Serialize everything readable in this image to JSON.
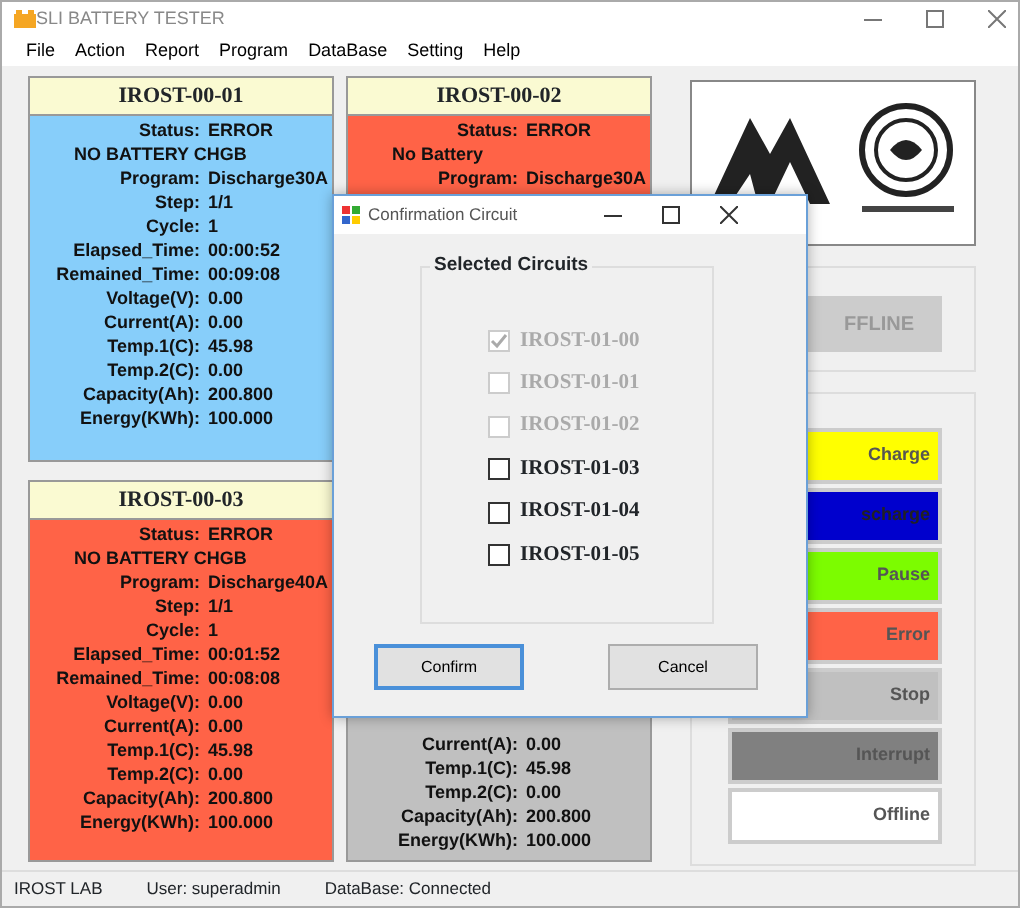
{
  "window": {
    "title": "SLI BATTERY TESTER"
  },
  "menu": [
    "File",
    "Action",
    "Report",
    "Program",
    "DataBase",
    "Setting",
    "Help"
  ],
  "circuits": [
    {
      "title": "IROST-00-01",
      "color": "#87cefa",
      "rows": [
        {
          "kind": "field",
          "label": "Status:",
          "value": "ERROR"
        },
        {
          "kind": "message",
          "text": "NO BATTERY CHGB"
        },
        {
          "kind": "field",
          "label": "Program:",
          "value": "Discharge30A"
        },
        {
          "kind": "field",
          "label": "Step:",
          "value": "1/1"
        },
        {
          "kind": "field",
          "label": "Cycle:",
          "value": "1"
        },
        {
          "kind": "field",
          "label": "Elapsed_Time:",
          "value": "00:00:52"
        },
        {
          "kind": "field",
          "label": "Remained_Time:",
          "value": "00:09:08"
        },
        {
          "kind": "field",
          "label": "Voltage(V):",
          "value": "0.00"
        },
        {
          "kind": "field",
          "label": "Current(A):",
          "value": "0.00"
        },
        {
          "kind": "field",
          "label": "Temp.1(C):",
          "value": "45.98"
        },
        {
          "kind": "field",
          "label": "Temp.2(C):",
          "value": "0.00"
        },
        {
          "kind": "field",
          "label": "Capacity(Ah):",
          "value": "200.800"
        },
        {
          "kind": "field",
          "label": "Energy(KWh):",
          "value": "100.000"
        }
      ]
    },
    {
      "title": "IROST-00-02",
      "color": "#ff6347",
      "rows": [
        {
          "kind": "field",
          "label": "Status:",
          "value": "ERROR"
        },
        {
          "kind": "message",
          "text": "No Battery"
        },
        {
          "kind": "field",
          "label": "Program:",
          "value": "Discharge30A"
        }
      ]
    },
    {
      "title": "IROST-00-03",
      "color": "#ff6347",
      "rows": [
        {
          "kind": "field",
          "label": "Status:",
          "value": "ERROR"
        },
        {
          "kind": "message",
          "text": "NO BATTERY CHGB"
        },
        {
          "kind": "field",
          "label": "Program:",
          "value": "Discharge40A"
        },
        {
          "kind": "field",
          "label": "Step:",
          "value": "1/1"
        },
        {
          "kind": "field",
          "label": "Cycle:",
          "value": "1"
        },
        {
          "kind": "field",
          "label": "Elapsed_Time:",
          "value": "00:01:52"
        },
        {
          "kind": "field",
          "label": "Remained_Time:",
          "value": "00:08:08"
        },
        {
          "kind": "field",
          "label": "Voltage(V):",
          "value": "0.00"
        },
        {
          "kind": "field",
          "label": "Current(A):",
          "value": "0.00"
        },
        {
          "kind": "field",
          "label": "Temp.1(C):",
          "value": "45.98"
        },
        {
          "kind": "field",
          "label": "Temp.2(C):",
          "value": "0.00"
        },
        {
          "kind": "field",
          "label": "Capacity(Ah):",
          "value": "200.800"
        },
        {
          "kind": "field",
          "label": "Energy(KWh):",
          "value": "100.000"
        }
      ]
    },
    {
      "color": "#c0c0c0",
      "rows": [
        {
          "kind": "field",
          "label": "Current(A):",
          "value": "0.00"
        },
        {
          "kind": "field",
          "label": "Temp.1(C):",
          "value": "45.98"
        },
        {
          "kind": "field",
          "label": "Temp.2(C):",
          "value": "0.00"
        },
        {
          "kind": "field",
          "label": "Capacity(Ah):",
          "value": "200.800"
        },
        {
          "kind": "field",
          "label": "Energy(KWh):",
          "value": "100.000"
        }
      ]
    }
  ],
  "mode_button": {
    "label": "FFLINE",
    "disabled": true
  },
  "legend": [
    {
      "label": "Charge",
      "color": "#ffff00"
    },
    {
      "label": "scharge",
      "color": "#0000cd"
    },
    {
      "label": "Pause",
      "color": "#7cfc00"
    },
    {
      "label": "Error",
      "color": "#ff6347"
    },
    {
      "label": "Stop",
      "color": "#c0c0c0"
    },
    {
      "label": "Interrupt",
      "color": "#808080"
    },
    {
      "label": "Offline",
      "color": "#ffffff"
    }
  ],
  "status_bar": [
    "IROST LAB",
    "User:  superadmin",
    "DataBase:  Connected"
  ],
  "dialog": {
    "title": "Confirmation Circuit",
    "group_title": "Selected Circuits",
    "items": [
      {
        "label": "IROST-01-00",
        "checked": true,
        "disabled": true
      },
      {
        "label": "IROST-01-01",
        "checked": false,
        "disabled": true
      },
      {
        "label": "IROST-01-02",
        "checked": false,
        "disabled": true
      },
      {
        "label": "IROST-01-03",
        "checked": false,
        "disabled": false
      },
      {
        "label": "IROST-01-04",
        "checked": false,
        "disabled": false
      },
      {
        "label": "IROST-01-05",
        "checked": false,
        "disabled": false
      }
    ],
    "buttons": [
      {
        "label": "Confirm",
        "focused": true
      },
      {
        "label": "Cancel",
        "focused": false
      }
    ]
  }
}
